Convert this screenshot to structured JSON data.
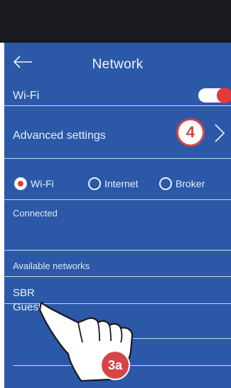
{
  "header": {
    "title": "Network"
  },
  "wifi": {
    "label": "Wi-Fi",
    "enabled": true
  },
  "advanced": {
    "label": "Advanced settings",
    "callout": "4"
  },
  "mode": {
    "options": [
      "Wi-Fi",
      "Internet",
      "Broker"
    ],
    "selected": "Wi-Fi"
  },
  "sections": {
    "connected_label": "Connected",
    "available_label": "Available networks"
  },
  "networks": [
    "SBR",
    "Guest"
  ],
  "annotation": {
    "step": "3a"
  },
  "colors": {
    "background": "#2b59a8",
    "accent": "#e53a3a",
    "callout": "#d64545"
  }
}
